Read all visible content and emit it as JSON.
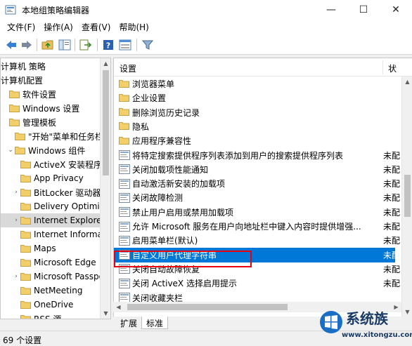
{
  "window": {
    "title": "本地组策略编辑器",
    "minimize_glyph": "—",
    "maximize_glyph": "☐",
    "close_glyph": "✕"
  },
  "menu": [
    "文件(F)",
    "操作(A)",
    "查看(V)",
    "帮助(H)"
  ],
  "toolbar": [
    "back-icon",
    "forward-icon",
    "up-folder-icon",
    "show-hide-tree-icon",
    "export-list-icon",
    "help-icon",
    "properties-icon",
    "filter-icon"
  ],
  "tree": [
    {
      "label": "计算机 策略",
      "indent": 0,
      "arrow": "",
      "folder": false
    },
    {
      "label": "计算机配置",
      "indent": 0,
      "arrow": "",
      "folder": false
    },
    {
      "label": "软件设置",
      "indent": 1,
      "arrow": "",
      "folder": true
    },
    {
      "label": "Windows 设置",
      "indent": 1,
      "arrow": "",
      "folder": true
    },
    {
      "label": "管理模板",
      "indent": 1,
      "arrow": "",
      "folder": true
    },
    {
      "label": "\"开始\"菜单和任务栏",
      "indent": 2,
      "arrow": "",
      "folder": true
    },
    {
      "label": "Windows 组件",
      "indent": 2,
      "arrow": "⌄",
      "folder": true
    },
    {
      "label": "ActiveX 安装程序",
      "indent": 3,
      "arrow": "",
      "folder": true
    },
    {
      "label": "App Privacy",
      "indent": 3,
      "arrow": "",
      "folder": true
    },
    {
      "label": "BitLocker 驱动器",
      "indent": 3,
      "arrow": "›",
      "folder": true
    },
    {
      "label": "Delivery Optimization",
      "indent": 3,
      "arrow": "",
      "folder": true
    },
    {
      "label": "Internet Explorer",
      "indent": 3,
      "arrow": "›",
      "folder": true,
      "selected": true
    },
    {
      "label": "Internet Information",
      "indent": 3,
      "arrow": "",
      "folder": true
    },
    {
      "label": "Maps",
      "indent": 3,
      "arrow": "",
      "folder": true
    },
    {
      "label": "Microsoft Edge",
      "indent": 3,
      "arrow": "",
      "folder": true
    },
    {
      "label": "Microsoft Passport",
      "indent": 3,
      "arrow": "›",
      "folder": true
    },
    {
      "label": "NetMeeting",
      "indent": 3,
      "arrow": "",
      "folder": true
    },
    {
      "label": "OneDrive",
      "indent": 3,
      "arrow": "",
      "folder": true
    },
    {
      "label": "RSS 源",
      "indent": 3,
      "arrow": "",
      "folder": true
    }
  ],
  "list": {
    "col_setting": "设置",
    "col_state": "状",
    "rows": [
      {
        "label": "浏览器菜单",
        "type": "folder",
        "state": ""
      },
      {
        "label": "企业设置",
        "type": "folder",
        "state": ""
      },
      {
        "label": "删除浏览历史记录",
        "type": "folder",
        "state": ""
      },
      {
        "label": "隐私",
        "type": "folder",
        "state": ""
      },
      {
        "label": "应用程序兼容性",
        "type": "folder",
        "state": ""
      },
      {
        "label": "将特定搜索提供程序列表添加到用户的搜索提供程序列表",
        "type": "setting",
        "state": "未配"
      },
      {
        "label": "关闭加载项性能通知",
        "type": "setting",
        "state": "未配"
      },
      {
        "label": "自动激活新安装的加载项",
        "type": "setting",
        "state": "未配"
      },
      {
        "label": "关闭故障检测",
        "type": "setting",
        "state": "未配"
      },
      {
        "label": "禁止用户启用或禁用加载项",
        "type": "setting",
        "state": "未配"
      },
      {
        "label": "允许 Microsoft 服务在用户向地址栏中键入内容时提供增强...",
        "type": "setting",
        "state": "未配"
      },
      {
        "label": "启用菜单栏(默认)",
        "type": "setting",
        "state": "未配"
      },
      {
        "label": "自定义用户代理字符串",
        "type": "setting",
        "state": "未配",
        "selected": true
      },
      {
        "label": "关闭自动故障恢复",
        "type": "setting",
        "state": "未配"
      },
      {
        "label": "关闭 ActiveX 选择启用提示",
        "type": "setting",
        "state": "未配"
      },
      {
        "label": "关闭收藏夹栏",
        "type": "setting",
        "state": ""
      }
    ]
  },
  "tabs": [
    "扩展",
    "标准"
  ],
  "status": "69 个设置",
  "watermark": {
    "text": "系统族",
    "url": "www.xitongzu.com"
  }
}
